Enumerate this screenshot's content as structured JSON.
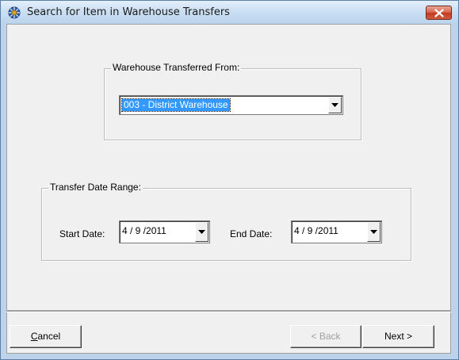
{
  "window": {
    "title": "Search for Item in Warehouse Transfers"
  },
  "warehouse_group": {
    "legend": "Warehouse Transferred From:",
    "selected": "003 - District Warehouse"
  },
  "date_group": {
    "legend": "Transfer Date Range:",
    "start_label": "Start Date:",
    "start_value": "4 / 9 /2011",
    "end_label": "End Date:",
    "end_value": "4 / 9 /2011"
  },
  "buttons": {
    "cancel_accel": "C",
    "cancel_rest": "ancel",
    "back": "< Back",
    "next": "Next >"
  },
  "colors": {
    "selection": "#3399ff",
    "close_button": "#c4391f",
    "titlebar": "#cbdff3"
  },
  "icons": {
    "app": "gear-globe-icon",
    "close": "close-icon",
    "dropdown": "chevron-down-icon"
  }
}
